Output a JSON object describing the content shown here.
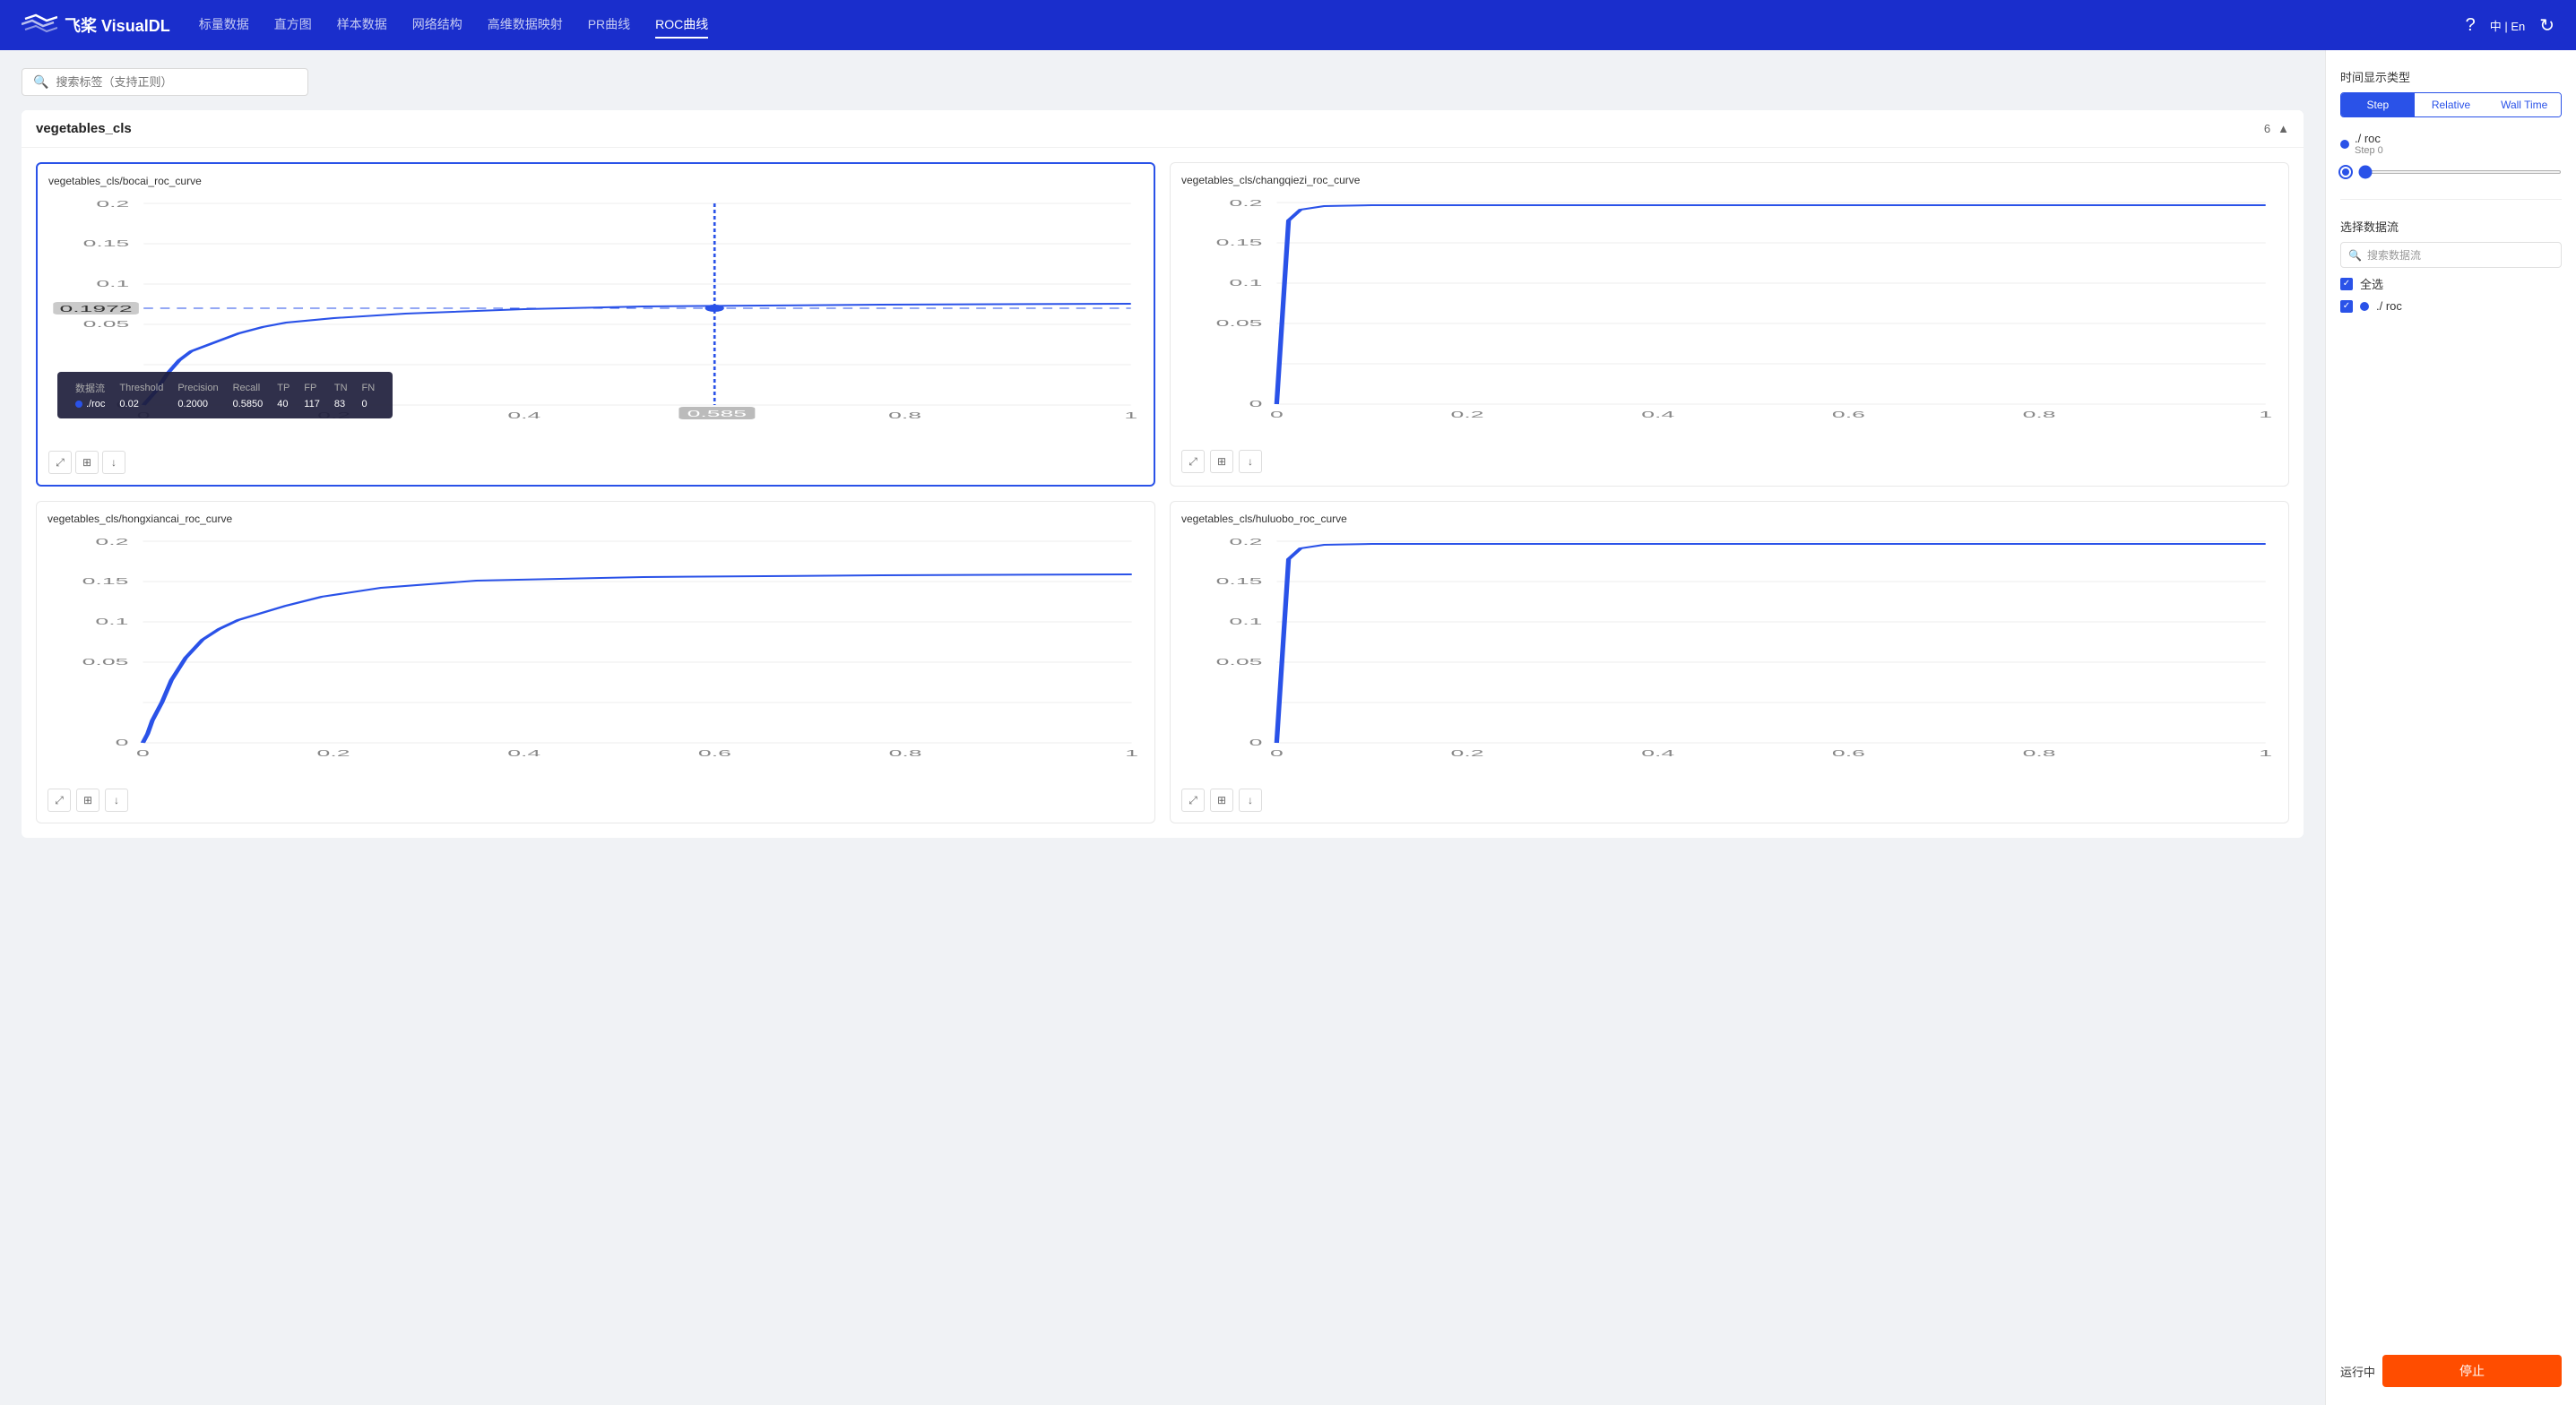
{
  "app": {
    "logo_text": "飞桨 VisualDL",
    "nav_links": [
      "标量数据",
      "直方图",
      "样本数据",
      "网络结构",
      "高维数据映射",
      "PR曲线",
      "ROC曲线"
    ],
    "active_nav": "ROC曲线",
    "lang": "中 | En"
  },
  "search": {
    "placeholder": "搜索标签（支持正则）"
  },
  "section": {
    "title": "vegetables_cls",
    "count": "6",
    "collapse_icon": "▲"
  },
  "charts": [
    {
      "id": "bocai",
      "title": "vegetables_cls/bocai_roc_curve",
      "active": true,
      "has_tooltip": true,
      "crosshair_x": 0.585,
      "crosshair_y": 0.1972,
      "ymax": 0.2,
      "tooltip": {
        "headers": [
          "数据流",
          "Threshold",
          "Precision",
          "Recall",
          "TP",
          "FP",
          "TN",
          "FN"
        ],
        "row": [
          "./ roc",
          "0.02",
          "0.2000",
          "0.5850",
          "40",
          "117",
          "83",
          "0"
        ]
      }
    },
    {
      "id": "changqiezi",
      "title": "vegetables_cls/changqiezi_roc_curve",
      "active": false,
      "has_tooltip": false,
      "ymax": 0.2
    },
    {
      "id": "hongxiancai",
      "title": "vegetables_cls/hongxiancai_roc_curve",
      "active": false,
      "has_tooltip": false,
      "ymax": 0.2
    },
    {
      "id": "huluobo",
      "title": "vegetables_cls/huluobo_roc_curve",
      "active": false,
      "has_tooltip": false,
      "ymax": 0.2
    }
  ],
  "sidebar": {
    "time_type_label": "时间显示类型",
    "time_types": [
      "Step",
      "Relative",
      "Wall Time"
    ],
    "active_time_type": "Step",
    "datasource_label": "./ roc",
    "datasource_step": "Step 0",
    "select_datasource_label": "选择数据流",
    "select_datasource_placeholder": "搜索数据流",
    "select_all_label": "全选",
    "datasource_item_label": "./ roc",
    "running_label": "运行中",
    "stop_label": "停止"
  }
}
